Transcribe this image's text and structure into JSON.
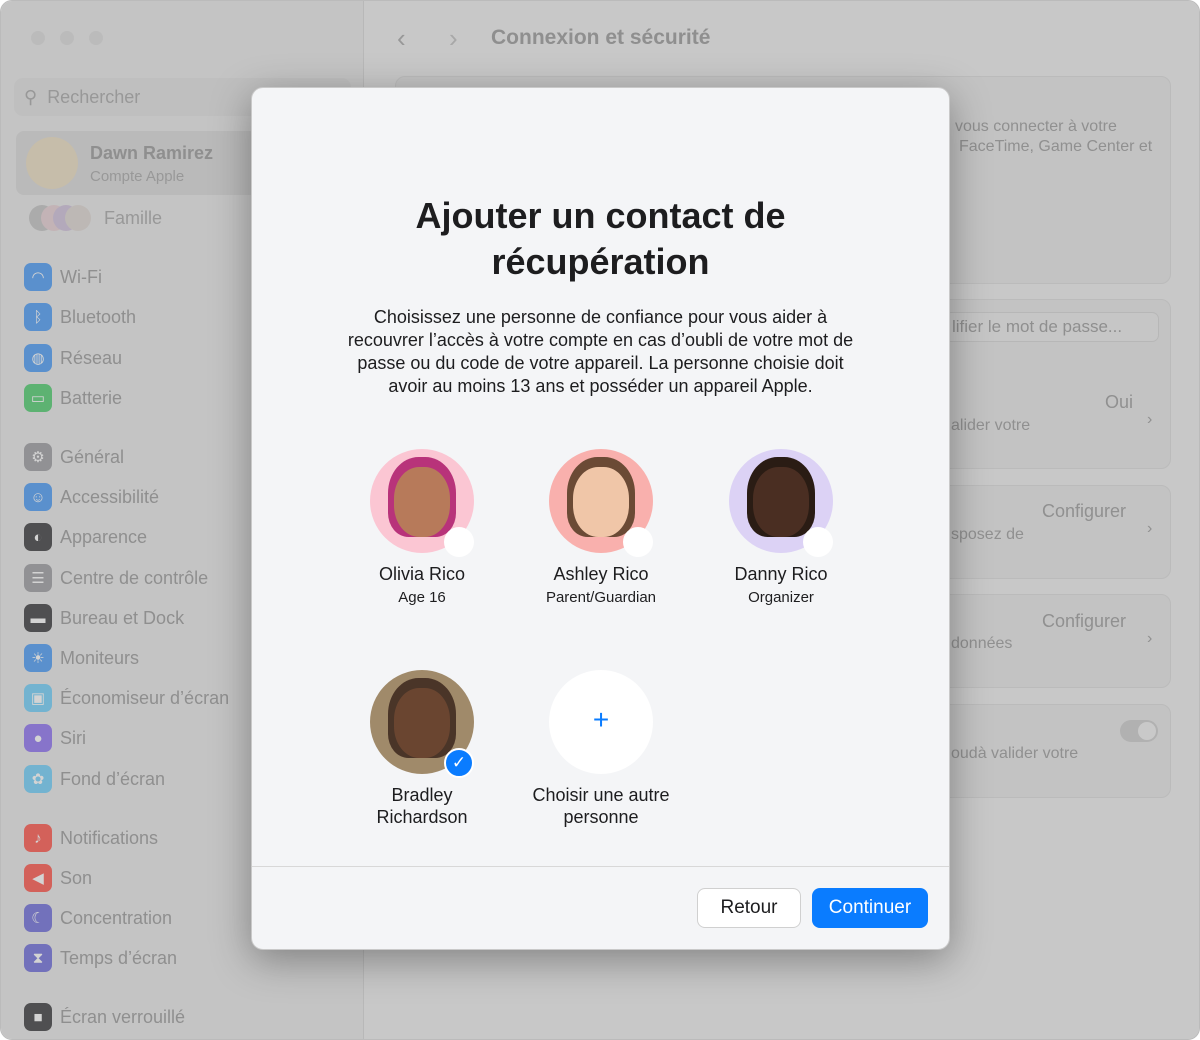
{
  "window": {
    "title": "Connexion et sécurité"
  },
  "sidebar": {
    "search_placeholder": "Rechercher",
    "account": {
      "name": "Dawn Ramirez",
      "subtitle": "Compte Apple"
    },
    "family": "Famille",
    "items": [
      {
        "label": "Wi-Fi",
        "icon": "wifi-icon",
        "color": "#2f8cf5"
      },
      {
        "label": "Bluetooth",
        "icon": "bluetooth-icon",
        "color": "#2f8cf5"
      },
      {
        "label": "Réseau",
        "icon": "globe-icon",
        "color": "#2f8cf5"
      },
      {
        "label": "Batterie",
        "icon": "battery-icon",
        "color": "#34c759"
      },
      {
        "label": "Général",
        "icon": "gear-icon",
        "color": "#8e8e93"
      },
      {
        "label": "Accessibilité",
        "icon": "accessibility-icon",
        "color": "#2f8cf5"
      },
      {
        "label": "Apparence",
        "icon": "appearance-icon",
        "color": "#1d1d1f"
      },
      {
        "label": "Centre de contrôle",
        "icon": "control-center-icon",
        "color": "#8e8e93"
      },
      {
        "label": "Bureau et Dock",
        "icon": "dock-icon",
        "color": "#1d1d1f"
      },
      {
        "label": "Moniteurs",
        "icon": "display-icon",
        "color": "#2f8cf5"
      },
      {
        "label": "Économiseur d’écran",
        "icon": "screensaver-icon",
        "color": "#5ac8fa"
      },
      {
        "label": "Siri",
        "icon": "siri-icon",
        "color": "#7d5cf0"
      },
      {
        "label": "Fond d’écran",
        "icon": "wallpaper-icon",
        "color": "#5ac8fa"
      },
      {
        "label": "Notifications",
        "icon": "bell-icon",
        "color": "#ff3b30"
      },
      {
        "label": "Son",
        "icon": "speaker-icon",
        "color": "#ff3b30"
      },
      {
        "label": "Concentration",
        "icon": "moon-icon",
        "color": "#5856d6"
      },
      {
        "label": "Temps d’écran",
        "icon": "hourglass-icon",
        "color": "#5856d6"
      },
      {
        "label": "Écran verrouillé",
        "icon": "lock-icon",
        "color": "#1d1d1f"
      }
    ]
  },
  "background": {
    "text1a": "vous connecter à votre",
    "text1b": "FaceTime, Game Center et",
    "change_password": "lifier le mot de passe...",
    "row1_value": "Oui",
    "row1_text": "alider votre",
    "row2_value": "Configurer",
    "row2_text": "sposez de",
    "row3_value": "Configurer",
    "row3_text": "données",
    "row4_text": "oudà valider votre"
  },
  "modal": {
    "title": "Ajouter un contact de récupération",
    "description": "Choisissez une personne de confiance pour vous aider à recouvrer l’accès à votre compte en cas d’oubli de votre mot de passe ou du code de votre appareil. La personne choisie doit avoir au moins 13 ans et posséder un appareil Apple.",
    "people": [
      {
        "name": "Olivia Rico",
        "subtitle": "Age 16",
        "bg": "#fbc6d3",
        "selected": false
      },
      {
        "name": "Ashley Rico",
        "subtitle": "Parent/Guardian",
        "bg": "#f9b0ad",
        "selected": false
      },
      {
        "name": "Danny Rico",
        "subtitle": "Organizer",
        "bg": "#dcd2f5",
        "selected": false
      },
      {
        "name": "Bradley Richardson",
        "subtitle": "",
        "bg": "#a08a6a",
        "selected": true
      }
    ],
    "add_other": "Choisir une autre personne",
    "back_button": "Retour",
    "continue_button": "Continuer",
    "accent": "#0a7cff"
  }
}
